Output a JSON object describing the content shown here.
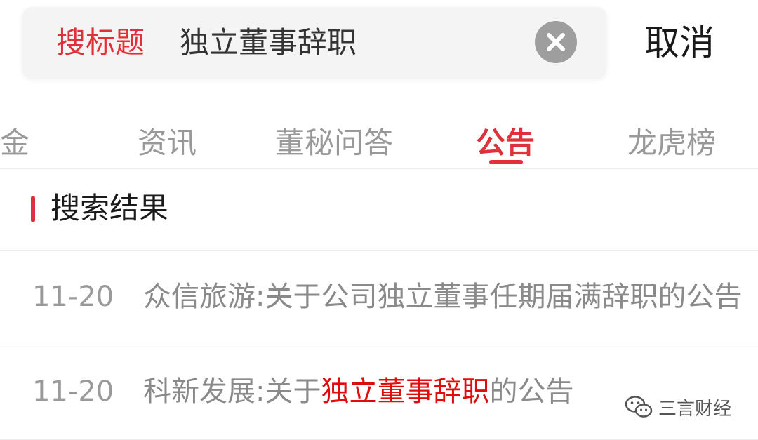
{
  "search": {
    "scope_label": "搜标题",
    "query": "独立董事辞职",
    "cancel_label": "取消"
  },
  "tabs": [
    {
      "label": "金",
      "active": false
    },
    {
      "label": "资讯",
      "active": false
    },
    {
      "label": "董秘问答",
      "active": false
    },
    {
      "label": "公告",
      "active": true
    },
    {
      "label": "龙虎榜",
      "active": false
    }
  ],
  "section": {
    "title": "搜索结果"
  },
  "results": [
    {
      "date": "11-20",
      "title": "众信旅游:关于公司独立董事任期届满辞职的公告",
      "title_pre": "众信旅游:关于公司独立董事任期届满辞职的公告",
      "highlight": "",
      "title_post": ""
    },
    {
      "date": "11-20",
      "title": "科新发展:关于独立董事辞职的公告",
      "title_pre": "科新发展:关于",
      "highlight": "独立董事辞职",
      "title_post": "的公告"
    }
  ],
  "watermark": {
    "text": "三言财经",
    "icon": "wechat-icon"
  },
  "colors": {
    "accent": "#e0303a",
    "highlight": "#e00d0d",
    "muted": "#999999"
  }
}
